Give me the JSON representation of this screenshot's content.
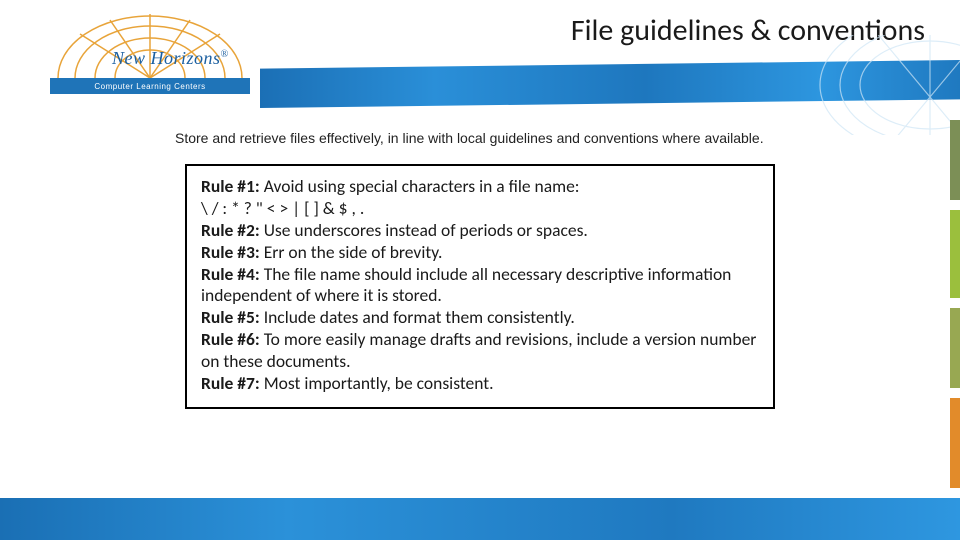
{
  "logo": {
    "name": "New Horizons",
    "tagline": "Computer Learning Centers",
    "registered": "®"
  },
  "page_title": "File guidelines & conventions",
  "intro_text": "Store and retrieve files effectively, in line with local guidelines and conventions where available.",
  "rules": [
    {
      "label": "Rule #1:",
      "text": "  Avoid using special characters in a file name:"
    },
    {
      "label": "",
      "text": "\\ / : * ? \" < > | [ ] & $ , ."
    },
    {
      "label": "Rule #2:",
      "text": " Use underscores instead of periods or spaces."
    },
    {
      "label": "Rule #3:",
      "text": " Err on the side of brevity."
    },
    {
      "label": "Rule #4:",
      "text": " The file name should include all necessary descriptive information independent of where it is stored."
    },
    {
      "label": "Rule #5:",
      "text": " Include dates and format them consistently."
    },
    {
      "label": "Rule #6:",
      "text": " To more easily manage drafts and revisions, include a version number on these documents."
    },
    {
      "label": "Rule #7:",
      "text": " Most importantly, be consistent."
    }
  ],
  "sidebar_colors": [
    "#7c8f56",
    "#9bbf3d",
    "#98a852",
    "#e28b2a"
  ],
  "sidebar_heights": [
    80,
    88,
    80,
    90
  ]
}
